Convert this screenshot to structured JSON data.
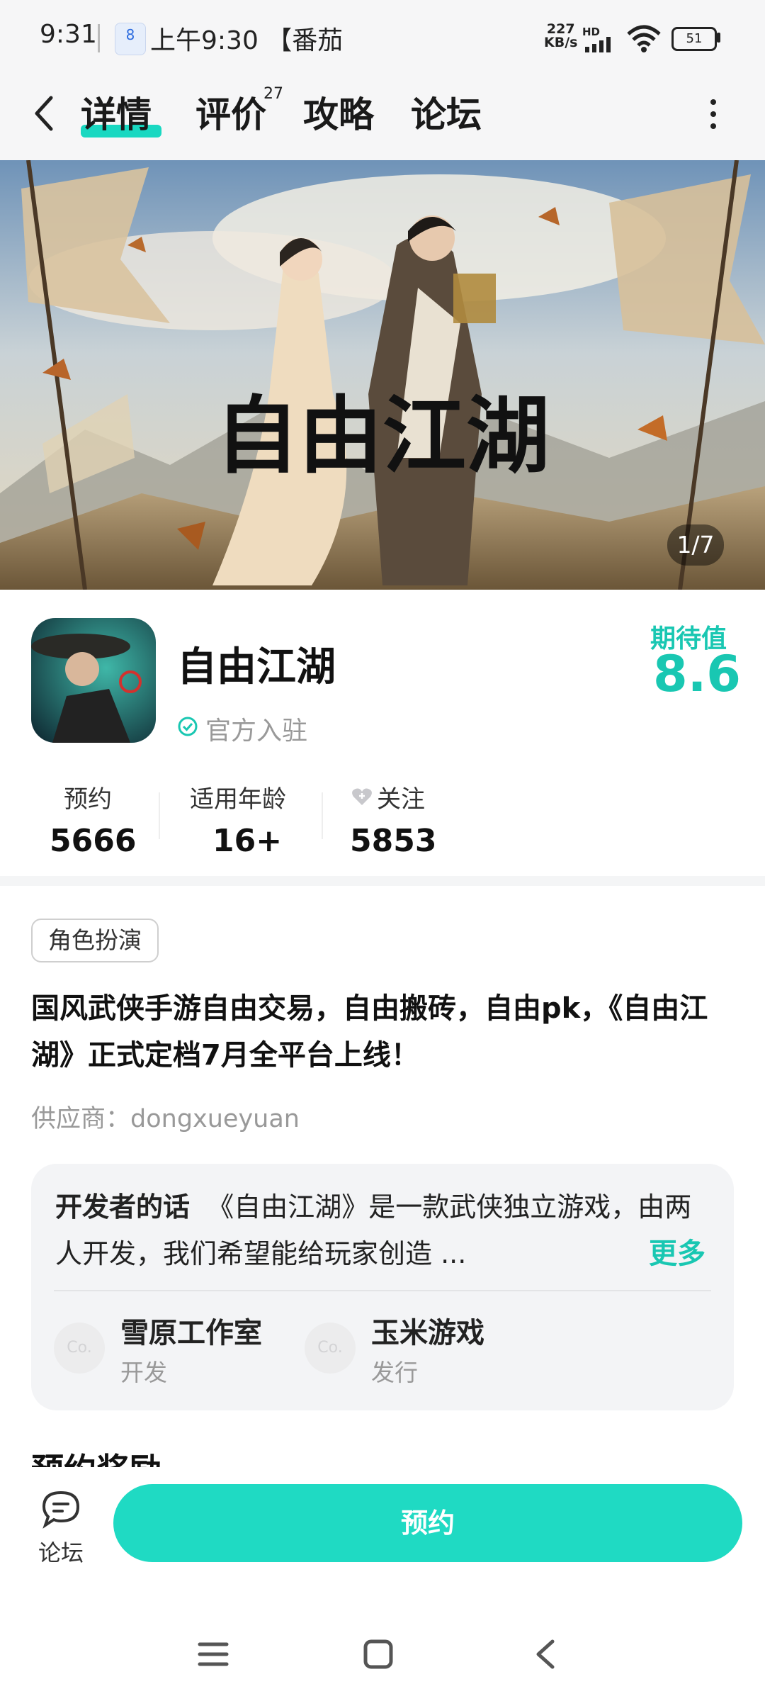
{
  "status_bar": {
    "time": "9:31",
    "calendar_badge": "8",
    "notification": "上午9:30 【番茄",
    "net_speed_value": "227",
    "net_speed_unit": "KB/s",
    "hd_label": "HD",
    "battery": "51"
  },
  "nav": {
    "tabs": [
      "详情",
      "评价",
      "攻略",
      "论坛"
    ],
    "review_count": "27",
    "active_tab": "详情"
  },
  "banner": {
    "title_art": "自由江湖",
    "counter": "1/7"
  },
  "app": {
    "name": "自由江湖",
    "verified": "官方入驻",
    "expectation_label": "期待值",
    "expectation_value": "8.6"
  },
  "stats": [
    {
      "label": "预约",
      "value": "5666"
    },
    {
      "label": "适用年龄",
      "value": "16+"
    },
    {
      "label": "关注",
      "value": "5853"
    }
  ],
  "tag": "角色扮演",
  "description": "国风武侠手游自由交易，自由搬砖，自由pk，《自由江湖》正式定档7月全平台上线！",
  "vendor": "供应商：dongxueyuan",
  "developer_note": {
    "heading": "开发者的话",
    "text": "《自由江湖》是一款武侠独立游戏，由两人开发，我们希望能给玩家创造 ...",
    "more": "更多"
  },
  "companies": [
    {
      "logo": "Co.",
      "name": "雪原工作室",
      "role": "开发"
    },
    {
      "logo": "Co.",
      "name": "玉米游戏",
      "role": "发行"
    }
  ],
  "reward_section_title": "预约奖励",
  "bottom": {
    "forum_label": "论坛",
    "reserve_button": "预约"
  },
  "colors": {
    "accent": "#19C7B2",
    "button": "#1FDAC3"
  }
}
